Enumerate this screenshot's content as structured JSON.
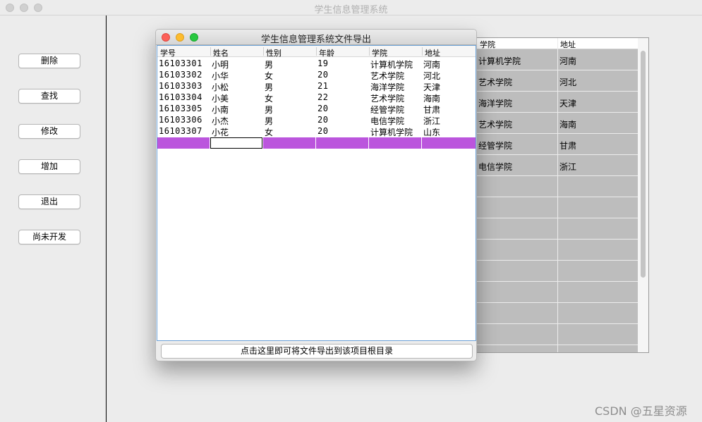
{
  "main": {
    "title": "学生信息管理系统"
  },
  "sidebar": {
    "buttons": [
      {
        "label": "删除"
      },
      {
        "label": "查找"
      },
      {
        "label": "修改"
      },
      {
        "label": "增加"
      },
      {
        "label": "退出"
      },
      {
        "label": "尚未开发"
      }
    ]
  },
  "background_table": {
    "headers": [
      "学院",
      "地址"
    ],
    "rows": [
      [
        "计算机学院",
        "河南"
      ],
      [
        "艺术学院",
        "河北"
      ],
      [
        "海洋学院",
        "天津"
      ],
      [
        "艺术学院",
        "海南"
      ],
      [
        "经管学院",
        "甘肃"
      ],
      [
        "电信学院",
        "浙江"
      ]
    ]
  },
  "dialog": {
    "title": "学生信息管理系统文件导出",
    "headers": [
      "学号",
      "姓名",
      "性别",
      "年龄",
      "学院",
      "地址"
    ],
    "rows": [
      [
        "16103301",
        "小明",
        "男",
        "19",
        "计算机学院",
        "河南"
      ],
      [
        "16103302",
        "小华",
        "女",
        "20",
        "艺术学院",
        "河北"
      ],
      [
        "16103303",
        "小松",
        "男",
        "21",
        "海洋学院",
        "天津"
      ],
      [
        "16103304",
        "小美",
        "女",
        "22",
        "艺术学院",
        "海南"
      ],
      [
        "16103305",
        "小南",
        "男",
        "20",
        "经管学院",
        "甘肃"
      ],
      [
        "16103306",
        "小杰",
        "男",
        "20",
        "电信学院",
        "浙江"
      ],
      [
        "16103307",
        "小花",
        "女",
        "20",
        "计算机学院",
        "山东"
      ]
    ],
    "export_button": "点击这里即可将文件导出到该项目根目录"
  },
  "colors": {
    "selection": "#bb55dd",
    "row_gray": "#bdbdbd",
    "close": "#fc5f57",
    "minimize": "#fdbc2e",
    "zoom": "#28c840"
  },
  "watermark": "CSDN @五星资源"
}
